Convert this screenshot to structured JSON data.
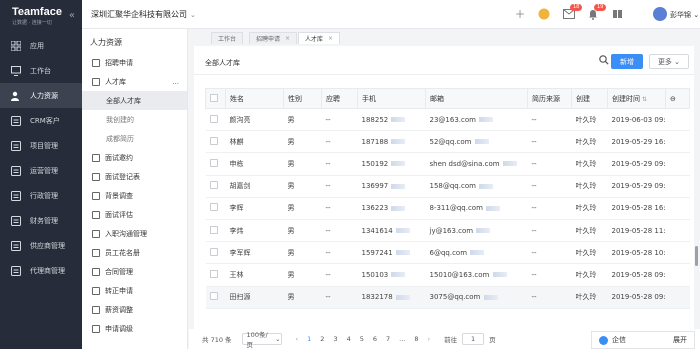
{
  "brand": {
    "title": "Teamface",
    "subtitle": "让数据 · 连接一切"
  },
  "nav": [
    {
      "label": "应用",
      "icon": "grid-icon"
    },
    {
      "label": "工作台",
      "icon": "monitor-icon"
    },
    {
      "label": "人力资源",
      "icon": "users-icon",
      "active": true
    },
    {
      "label": "CRM客户",
      "icon": "crm-icon"
    },
    {
      "label": "项目管理",
      "icon": "project-icon"
    },
    {
      "label": "运营管理",
      "icon": "operations-icon"
    },
    {
      "label": "行政管理",
      "icon": "admin-icon"
    },
    {
      "label": "财务管理",
      "icon": "finance-icon"
    },
    {
      "label": "供应商管理",
      "icon": "supplier-icon"
    },
    {
      "label": "代理商管理",
      "icon": "agent-icon"
    }
  ],
  "topbar": {
    "company": "深圳汇聚华企科技有限公司",
    "mail_badge": "18",
    "bell_badge": "19",
    "user": "彭华锦"
  },
  "side": {
    "title": "人力资源",
    "items": [
      {
        "label": "招聘申请"
      },
      {
        "label": "人才库",
        "more": "...",
        "subs": [
          {
            "label": "全部人才库",
            "active": true
          },
          {
            "label": "我创建的"
          },
          {
            "label": "成都简历"
          }
        ]
      },
      {
        "label": "面试邀约"
      },
      {
        "label": "面试登记表"
      },
      {
        "label": "背景调查"
      },
      {
        "label": "面试评估"
      },
      {
        "label": "入职沟通管理"
      },
      {
        "label": "员工花名册"
      },
      {
        "label": "合同管理"
      },
      {
        "label": "转正申请"
      },
      {
        "label": "薪资调整"
      },
      {
        "label": "申请调级"
      }
    ]
  },
  "tabs": [
    {
      "label": "工作台"
    },
    {
      "label": "招聘申请",
      "closable": true
    },
    {
      "label": "人才库",
      "closable": true,
      "active": true
    }
  ],
  "panel": {
    "title": "全部人才库",
    "new_label": "新增",
    "more_label": "更多"
  },
  "table": {
    "headers": [
      "姓名",
      "性别",
      "应聘",
      "手机",
      "邮箱",
      "简历来源",
      "创建",
      "创建时间"
    ],
    "rows": [
      [
        "颜沟亮",
        "男",
        "--",
        "188252",
        "23@163.com",
        "--",
        "叶久玲",
        "2019-06-03 09:54"
      ],
      [
        "林麒",
        "男",
        "--",
        "187188",
        "52@qq.com",
        "--",
        "叶久玲",
        "2019-05-29 16:41"
      ],
      [
        "申栋",
        "男",
        "--",
        "150192",
        "shen dsd@sina.com",
        "--",
        "叶久玲",
        "2019-05-29 09:20"
      ],
      [
        "胡嘉剑",
        "男",
        "--",
        "136997",
        "158@qq.com",
        "--",
        "叶久玲",
        "2019-05-29 09:18"
      ],
      [
        "李辉",
        "男",
        "--",
        "136223",
        "8-311@qq.com",
        "--",
        "叶久玲",
        "2019-05-28 16:12"
      ],
      [
        "李炜",
        "男",
        "--",
        "1341614",
        "jy@163.com",
        "--",
        "叶久玲",
        "2019-05-28 11:14"
      ],
      [
        "李军辉",
        "男",
        "--",
        "1597241",
        "6@qq.com",
        "--",
        "叶久玲",
        "2019-05-28 10:21"
      ],
      [
        "王林",
        "男",
        "--",
        "150103",
        "15010@163.com",
        "--",
        "叶久玲",
        "2019-05-28 09:57"
      ],
      [
        "田扫源",
        "男",
        "--",
        "1832178",
        "3075@qq.com",
        "--",
        "叶久玲",
        "2019-05-28 09:54"
      ]
    ]
  },
  "pager": {
    "total": "共 710 条",
    "size": "100条/页",
    "pages": [
      "1",
      "2",
      "3",
      "4",
      "5",
      "6",
      "7",
      "...",
      "8"
    ],
    "current": "1",
    "goto_label": "前往",
    "goto_value": "1",
    "page_suffix": "页"
  },
  "chat": {
    "label": "企信",
    "expand": "展开"
  }
}
